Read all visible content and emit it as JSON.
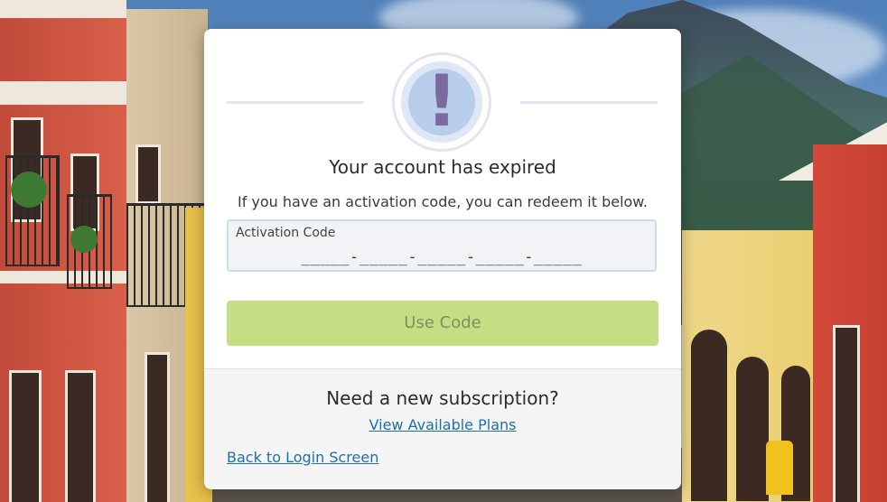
{
  "modal": {
    "title": "Your account has expired",
    "subtitle": "If you have an activation code, you can redeem it below.",
    "alert_icon": "exclamation-icon",
    "activation": {
      "label": "Activation Code",
      "mask": "_____-_____-_____-_____-_____"
    },
    "use_code_button": "Use Code",
    "footer": {
      "heading": "Need a new subscription?",
      "plans_link": "View Available Plans",
      "back_link": "Back to Login Screen"
    }
  },
  "colors": {
    "button_bg": "#c4df83",
    "button_text": "#7f8f64",
    "link": "#1f6fae",
    "alert_glyph": "#7a6aa0"
  }
}
